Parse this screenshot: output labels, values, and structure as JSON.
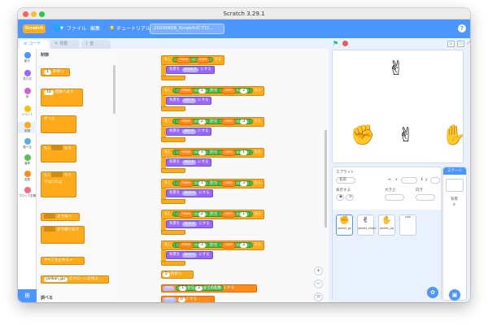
{
  "window": {
    "title": "Scratch 3.29.1"
  },
  "menubar": {
    "logo": "Scratch",
    "items": [
      "ファイル",
      "編集"
    ],
    "tutorial": "チュートリアル",
    "project_title": "20200608_Scratchのプロ..."
  },
  "tabs": [
    {
      "label": "コード",
      "icon": "code-icon"
    },
    {
      "label": "背景",
      "icon": "brush-icon"
    },
    {
      "label": "音",
      "icon": "sound-icon"
    }
  ],
  "categories": [
    {
      "label": "動き",
      "color": "#4c97ff"
    },
    {
      "label": "見た目",
      "color": "#9966ff"
    },
    {
      "label": "音",
      "color": "#cf63cf"
    },
    {
      "label": "イベント",
      "color": "#ffbf00"
    },
    {
      "label": "制御",
      "color": "#ffab19"
    },
    {
      "label": "調べる",
      "color": "#5cb1d6"
    },
    {
      "label": "演算",
      "color": "#59c059"
    },
    {
      "label": "変数",
      "color": "#ff8c1a"
    },
    {
      "label": "ブロック定義",
      "color": "#ff6680"
    }
  ],
  "palette": {
    "control_header": "制御",
    "wait_label": "秒待つ",
    "wait_value": "1",
    "repeat_label": "回繰り返す",
    "repeat_value": "10",
    "forever_label": "ずっと",
    "if_label_1": "もし",
    "then_label": "なら",
    "if_label_2": "もし",
    "else_then": "なら",
    "else_label": "でなければ",
    "wait_until": "まで待つ",
    "repeat_until": "まで繰り返す",
    "stop_label": "すべてを止める",
    "clone_sprite": "jankan_gu",
    "clone_label": "のクローンを作る",
    "sensing_header": "調べる"
  },
  "scripts": {
    "if_word": "もし",
    "then_word": "なら",
    "and_word": "かつ",
    "backdrop_set": "背景を",
    "to_word": "にする",
    "var_mine": "mine",
    "var_com": "com",
    "eq": "=",
    "blocks": [
      {
        "a": "mine",
        "b": "com",
        "result": "draw"
      },
      {
        "a": "1",
        "b": "2",
        "result": "win"
      },
      {
        "a": "2",
        "b": "3",
        "result": "win"
      },
      {
        "a": "3",
        "b": "1",
        "result": "win"
      },
      {
        "a": "1",
        "b": "3",
        "result": "lose"
      },
      {
        "a": "2",
        "b": "1",
        "result": "lose"
      },
      {
        "a": "3",
        "b": "2",
        "result": "lose"
      }
    ],
    "wait_value": "2",
    "wait_label": "秒待つ",
    "random_var": "com",
    "random_from": "1",
    "random_kara": "から",
    "random_to": "3",
    "random_label": "までの乱数",
    "random_set": "にする",
    "set_var": "mine",
    "set_val": "0",
    "set_label": "にする"
  },
  "sprite_info": {
    "sprite_label": "スプライト",
    "name_value": "名前",
    "x_label": "x",
    "y_label": "y",
    "show_label": "表示する",
    "size_label": "大きさ",
    "direction_label": "向き"
  },
  "sprites": [
    {
      "name": "janken_gu",
      "icon": "fist-icon",
      "glyph": "✊"
    },
    {
      "name": "janken_choki",
      "icon": "peace-icon",
      "glyph": "✌"
    },
    {
      "name": "janken_pa",
      "icon": "open-hand-icon",
      "glyph": "✋"
    },
    {
      "name": "com",
      "icon": "blank-sprite-icon",
      "glyph": ""
    }
  ],
  "stage_panel": {
    "header": "ステージ",
    "backdrop_label": "背景",
    "backdrop_count": "4"
  },
  "stage": {
    "hands": [
      "✊",
      "✌",
      "✋"
    ],
    "top_hand": "✌"
  }
}
